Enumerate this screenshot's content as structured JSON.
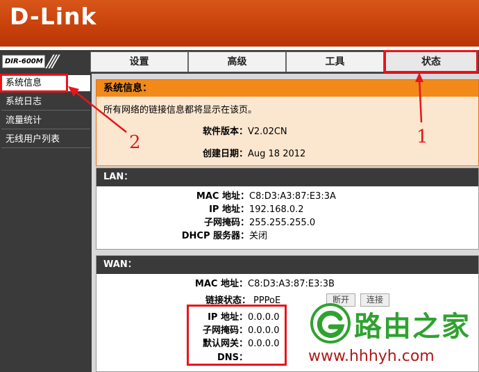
{
  "brand": {
    "logo_text": "D-Link",
    "model": "DIR-600M"
  },
  "nav": {
    "tabs": [
      {
        "label": "设置"
      },
      {
        "label": "高级"
      },
      {
        "label": "工具"
      },
      {
        "label": "状态"
      }
    ]
  },
  "sidebar": {
    "items": [
      {
        "label": "系统信息"
      },
      {
        "label": "系统日志"
      },
      {
        "label": "流量统计"
      },
      {
        "label": "无线用户列表"
      }
    ]
  },
  "sysinfo": {
    "title": "系统信息：",
    "description": "所有网络的链接信息都将显示在该页。",
    "firmware_label": "软件版本：",
    "firmware_value": "V2.02CN",
    "date_label": "创建日期：",
    "date_value": "Aug 18 2012"
  },
  "lan": {
    "title": "LAN：",
    "mac_label": "MAC 地址：",
    "mac_value": "C8:D3:A3:87:E3:3A",
    "ip_label": "IP 地址：",
    "ip_value": "192.168.0.2",
    "mask_label": "子网掩码：",
    "mask_value": "255.255.255.0",
    "dhcp_label": "DHCP 服务器：",
    "dhcp_value": "关闭"
  },
  "wan": {
    "title": "WAN：",
    "mac_label": "MAC 地址：",
    "mac_value": "C8:D3:A3:87:E3:3B",
    "conn_label": "链接状态：",
    "conn_value": "PPPoE",
    "disconnect_label": "断开",
    "connect_label": "连接",
    "ip_label": "IP 地址：",
    "ip_value": "0.0.0.0",
    "mask_label": "子网掩码：",
    "mask_value": "0.0.0.0",
    "gw_label": "默认网关：",
    "gw_value": "0.0.0.0",
    "dns_label": "DNS：",
    "dns_value": ""
  },
  "annotations": {
    "num1": "1",
    "num2": "2"
  },
  "watermark": {
    "text": "路由之家",
    "url": "www.hhhyh.com"
  },
  "colors": {
    "header": "#c7400a",
    "nav": "#3a3a3a",
    "orange": "#f28a1a",
    "annotation_red": "#e8141a",
    "watermark_green": "#2fa22f"
  }
}
